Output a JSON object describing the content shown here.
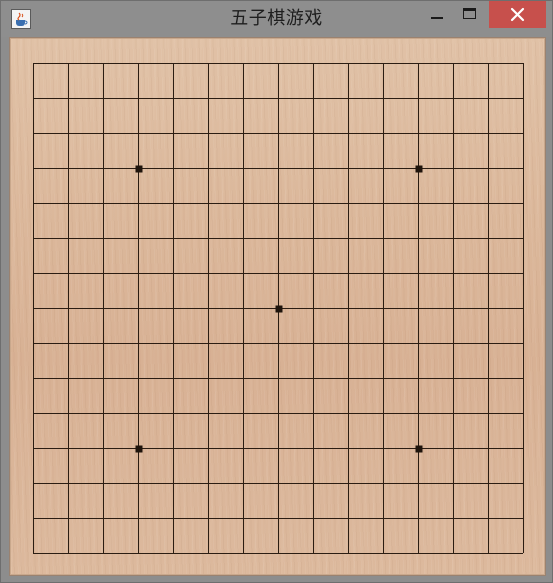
{
  "window": {
    "title": "五子棋游戏",
    "icon": "java-cup-icon",
    "controls": {
      "minimize": "minimize-icon",
      "maximize": "maximize-icon",
      "close": "close-icon",
      "close_color": "#c7504c"
    }
  },
  "board": {
    "grid_lines": 15,
    "star_points": [
      {
        "col": 3,
        "row": 3
      },
      {
        "col": 11,
        "row": 3
      },
      {
        "col": 7,
        "row": 7
      },
      {
        "col": 3,
        "row": 11
      },
      {
        "col": 11,
        "row": 11
      }
    ],
    "stones": [],
    "line_color": "#2b1d12",
    "wood_color": "#dcb99c"
  }
}
